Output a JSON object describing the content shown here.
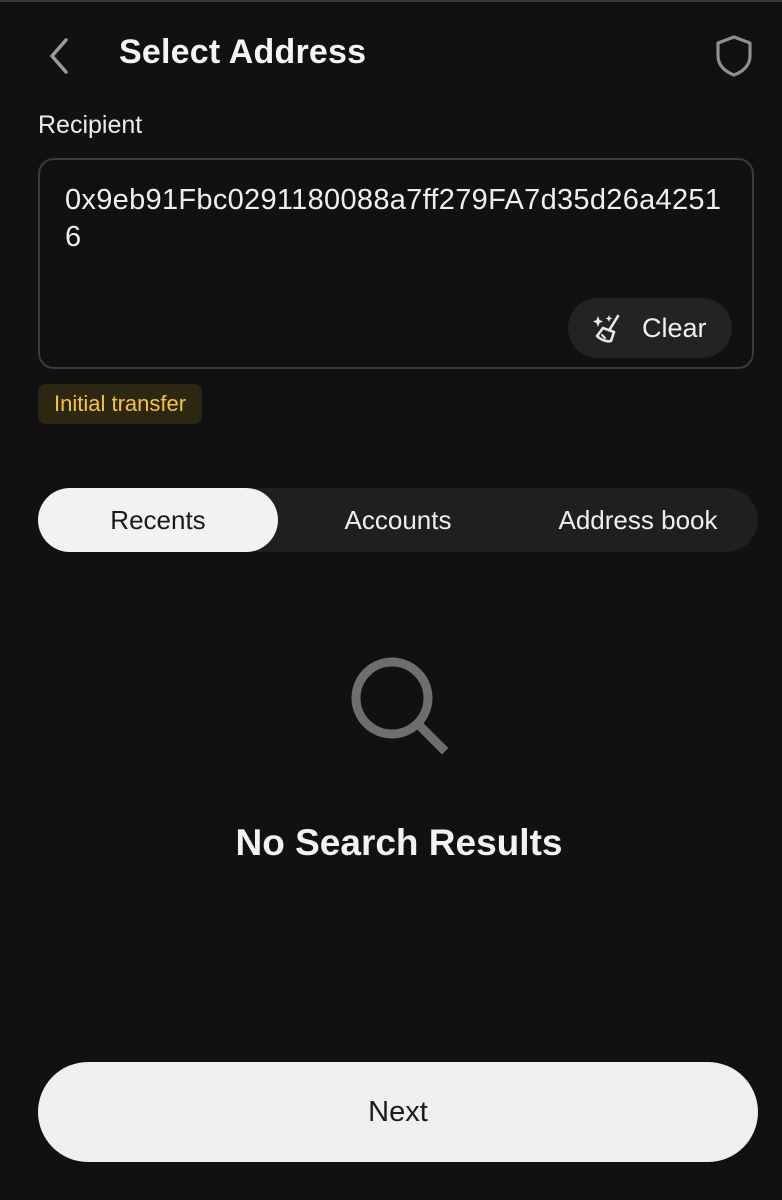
{
  "header": {
    "title": "Select Address",
    "back_icon": "chevron-left-icon",
    "shield_icon": "shield-icon"
  },
  "recipient": {
    "label": "Recipient",
    "value": "0x9eb91Fbc0291180088a7ff279FA7d35d26a42516",
    "clear_label": "Clear",
    "clear_icon": "broom-sparkle-icon"
  },
  "tag": {
    "label": "Initial transfer",
    "color": "#f3c53b",
    "background": "#2d2613"
  },
  "tabs": [
    {
      "label": "Recents",
      "active": true
    },
    {
      "label": "Accounts",
      "active": false
    },
    {
      "label": "Address book",
      "active": false
    }
  ],
  "empty_state": {
    "icon": "search-icon",
    "message": "No Search Results"
  },
  "footer": {
    "next_label": "Next"
  },
  "colors": {
    "background": "#111111",
    "text": "#f2f2f2",
    "button_light": "#efefef"
  }
}
